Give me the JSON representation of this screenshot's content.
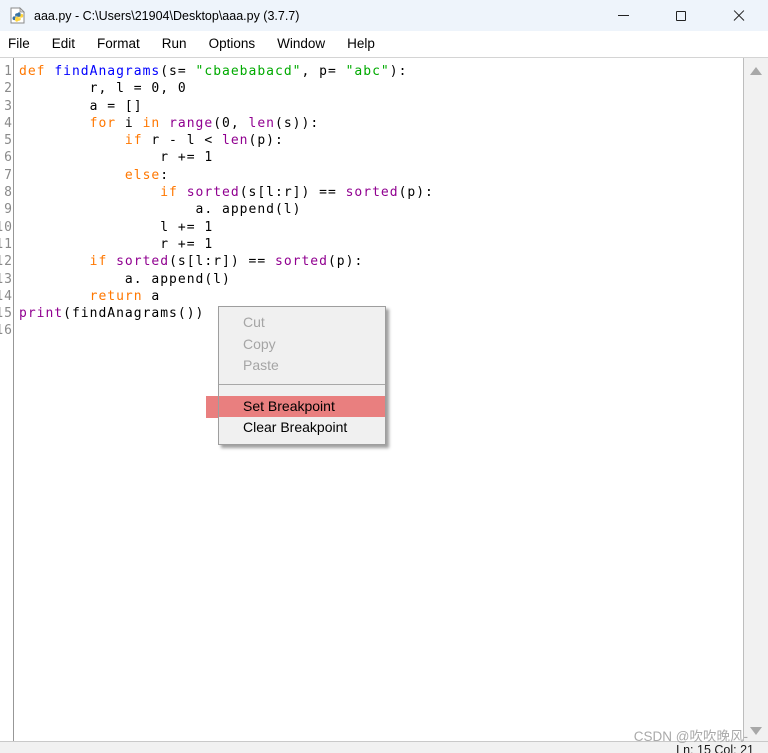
{
  "window": {
    "title": "aaa.py - C:\\Users\\21904\\Desktop\\aaa.py (3.7.7)"
  },
  "menubar": {
    "items": [
      "File",
      "Edit",
      "Format",
      "Run",
      "Options",
      "Window",
      "Help"
    ]
  },
  "editor": {
    "line_numbers": [
      1,
      2,
      3,
      4,
      5,
      6,
      7,
      8,
      9,
      10,
      11,
      12,
      13,
      14,
      15,
      16
    ],
    "lines": [
      [
        [
          "kw",
          "def"
        ],
        [
          "p",
          " "
        ],
        [
          "def",
          "findAnagrams"
        ],
        [
          "p",
          "(s= "
        ],
        [
          "str",
          "\"cbaebabacd\""
        ],
        [
          "p",
          ", p= "
        ],
        [
          "str",
          "\"abc\""
        ],
        [
          "p",
          "):"
        ]
      ],
      [
        [
          "p",
          "        r, l = 0, 0"
        ]
      ],
      [
        [
          "p",
          "        a = []"
        ]
      ],
      [
        [
          "p",
          "        "
        ],
        [
          "kw",
          "for"
        ],
        [
          "p",
          " i "
        ],
        [
          "kw",
          "in"
        ],
        [
          "p",
          " "
        ],
        [
          "bi",
          "range"
        ],
        [
          "p",
          "(0, "
        ],
        [
          "bi",
          "len"
        ],
        [
          "p",
          "(s)):"
        ]
      ],
      [
        [
          "p",
          "            "
        ],
        [
          "kw",
          "if"
        ],
        [
          "p",
          " r - l < "
        ],
        [
          "bi",
          "len"
        ],
        [
          "p",
          "(p):"
        ]
      ],
      [
        [
          "p",
          "                r += 1"
        ]
      ],
      [
        [
          "p",
          "            "
        ],
        [
          "kw",
          "else"
        ],
        [
          "p",
          ":"
        ]
      ],
      [
        [
          "p",
          "                "
        ],
        [
          "kw",
          "if"
        ],
        [
          "p",
          " "
        ],
        [
          "bi",
          "sorted"
        ],
        [
          "p",
          "(s[l:r]) == "
        ],
        [
          "bi",
          "sorted"
        ],
        [
          "p",
          "(p):"
        ]
      ],
      [
        [
          "p",
          "                    a. append(l)"
        ]
      ],
      [
        [
          "p",
          "                l += 1"
        ]
      ],
      [
        [
          "p",
          "                r += 1"
        ]
      ],
      [
        [
          "p",
          "        "
        ],
        [
          "kw",
          "if"
        ],
        [
          "p",
          " "
        ],
        [
          "bi",
          "sorted"
        ],
        [
          "p",
          "(s[l:r]) == "
        ],
        [
          "bi",
          "sorted"
        ],
        [
          "p",
          "(p):"
        ]
      ],
      [
        [
          "p",
          "            a. append(l)"
        ]
      ],
      [
        [
          "p",
          "        "
        ],
        [
          "kw",
          "return"
        ],
        [
          "p",
          " a"
        ]
      ],
      [
        [
          "bi",
          "print"
        ],
        [
          "p",
          "(findAnagrams())"
        ]
      ],
      []
    ]
  },
  "context_menu": {
    "items": [
      {
        "label": "Cut",
        "enabled": false,
        "highlighted": false
      },
      {
        "label": "Copy",
        "enabled": false,
        "highlighted": false
      },
      {
        "label": "Paste",
        "enabled": false,
        "highlighted": false
      },
      {
        "separator": true
      },
      {
        "label": "Set Breakpoint",
        "enabled": true,
        "highlighted": true
      },
      {
        "label": "Clear Breakpoint",
        "enabled": true,
        "highlighted": false
      }
    ]
  },
  "statusbar": {
    "position": "Ln: 15 Col: 21"
  },
  "watermark": "CSDN @吹吹晚风-",
  "colors": {
    "keyword": "#ff7700",
    "builtin": "#900090",
    "defname": "#0000ff",
    "string": "#00aa00",
    "linenum": "#8a8a8a",
    "disabled": "#a5a5a5",
    "breakpoint_red": "#e97f7f",
    "titlebar_bg": "#eef4fb",
    "menu_bg": "#f0f0f0",
    "watermark": "#a9a9a9"
  }
}
